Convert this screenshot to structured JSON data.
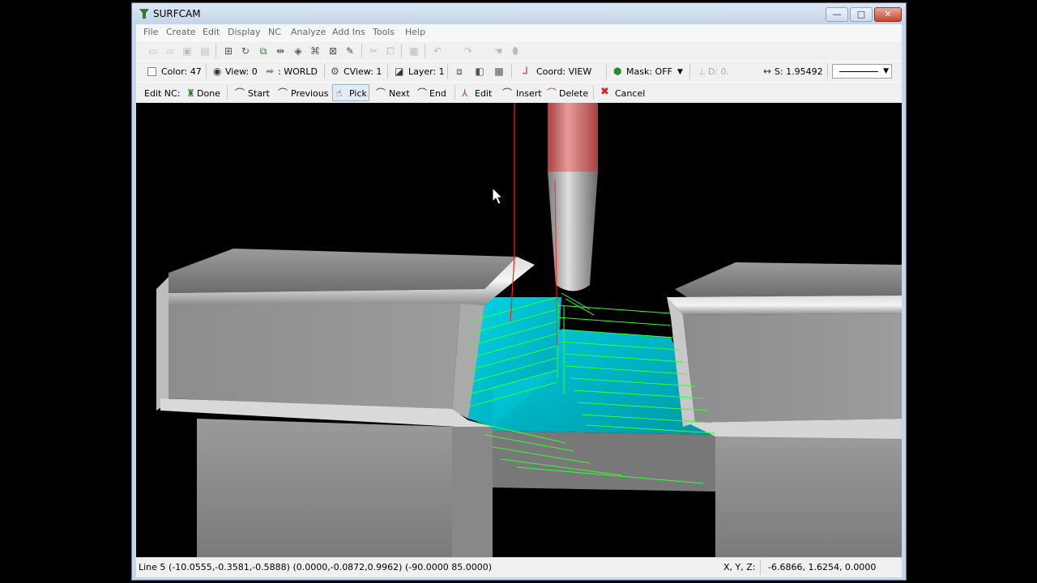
{
  "window": {
    "title": "SURFCAM",
    "minimize": "—",
    "maximize": "□",
    "close": "✕"
  },
  "menu": [
    "File",
    "Create",
    "Edit",
    "Display",
    "NC",
    "Analyze",
    "Add Ins",
    "Tools",
    "Help"
  ],
  "toolbar1": {
    "icons": [
      "new-file-icon",
      "open-folder-icon",
      "save-icon",
      "print-icon",
      "zoom-all-icon",
      "rotate-icon",
      "zoom-window-icon",
      "pan-icon",
      "fit-icon",
      "redraw-icon",
      "shade-icon",
      "eraser-icon",
      "cut-icon",
      "copy-icon",
      "paste-icon",
      "undo-icon",
      "redo-icon",
      "hand-icon",
      "cursor-icon"
    ]
  },
  "toolbar2": {
    "color": "Color: 47",
    "view": "View: 0",
    "world": ": WORLD",
    "cview": "CView: 1",
    "layer": "Layer: 1",
    "coord": "Coord: VIEW",
    "mask": "Mask: OFF",
    "depth": "D: 0.",
    "step": "S: 1.95492"
  },
  "toolbar3": {
    "title": "Edit NC:",
    "done": "Done",
    "start": "Start",
    "previous": "Previous",
    "pick": "Pick",
    "next": "Next",
    "end": "End",
    "edit": "Edit",
    "insert": "Insert",
    "delete": "Delete",
    "cancel": "Cancel"
  },
  "status": {
    "line": "Line 5",
    "values": "(-10.0555,-0.3581,-0.5888) (0.0000,-0.0872,0.9962) (-90.0000 85.0000)",
    "xyz_label": "X, Y, Z:",
    "xyz": "-6.6866, 1.6254, 0.0000"
  },
  "colors": {
    "toolpath": "#33ff33",
    "surface": "#00c8d8",
    "tool_holder": "#c85050",
    "part": "#9a9a9a"
  }
}
